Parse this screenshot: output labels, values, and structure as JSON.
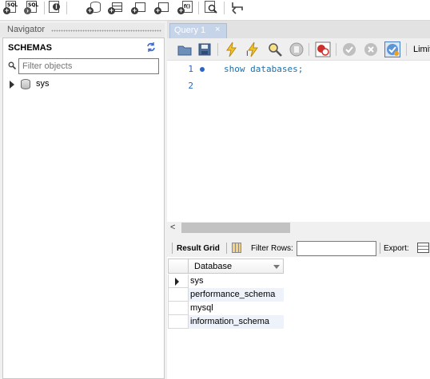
{
  "toolbar": {
    "buttons": [
      {
        "name": "new-sql-tab-button",
        "glyph": "SQL"
      },
      {
        "name": "open-sql-script-button",
        "glyph": "SQL"
      },
      {
        "name": "inspector-button",
        "glyph": "i"
      },
      {
        "name": "create-schema-button",
        "glyph": ""
      },
      {
        "name": "create-table-button",
        "glyph": ""
      },
      {
        "name": "create-view-button",
        "glyph": ""
      },
      {
        "name": "create-procedure-button",
        "glyph": ""
      },
      {
        "name": "create-function-button",
        "glyph": "f()"
      },
      {
        "name": "search-table-data-button",
        "glyph": ""
      },
      {
        "name": "reconnect-button",
        "glyph": ""
      }
    ]
  },
  "navigator": {
    "header": "Navigator",
    "section_title": "SCHEMAS",
    "filter_placeholder": "Filter objects",
    "schemas": [
      {
        "label": "sys"
      }
    ]
  },
  "query_tab": {
    "label": "Query 1",
    "close": "×"
  },
  "editor": {
    "limit_label": "Limit",
    "lines": [
      {
        "number": "1",
        "code": "show databases;"
      },
      {
        "number": "2",
        "code": ""
      }
    ],
    "scroll_arrow": "<"
  },
  "results": {
    "result_grid_label": "Result Grid",
    "filter_rows_label": "Filter Rows:",
    "filter_rows_value": "",
    "export_label": "Export:",
    "column_header": "Database",
    "rows": [
      "sys",
      "performance_schema",
      "mysql",
      "information_schema"
    ]
  }
}
